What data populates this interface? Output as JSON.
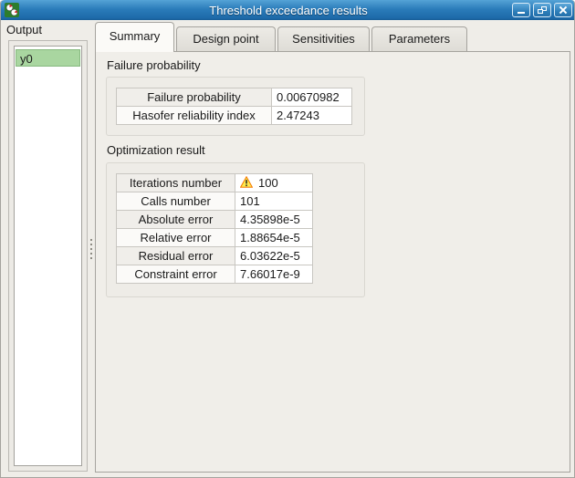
{
  "window": {
    "title": "Threshold exceedance results"
  },
  "sidebar": {
    "header": "Output",
    "items": [
      {
        "label": "y0",
        "selected": true
      }
    ]
  },
  "tabs": [
    {
      "label": "Summary",
      "active": true
    },
    {
      "label": "Design point",
      "active": false
    },
    {
      "label": "Sensitivities",
      "active": false
    },
    {
      "label": "Parameters",
      "active": false
    }
  ],
  "summary": {
    "failure_group": {
      "title": "Failure probability",
      "rows": [
        {
          "label": "Failure probability",
          "value": "0.00670982"
        },
        {
          "label": "Hasofer reliability index",
          "value": "2.47243"
        }
      ]
    },
    "optimization_group": {
      "title": "Optimization result",
      "rows": [
        {
          "label": "Iterations number",
          "value": "100",
          "warning": true
        },
        {
          "label": "Calls number",
          "value": "101"
        },
        {
          "label": "Absolute error",
          "value": "4.35898e-5"
        },
        {
          "label": "Relative error",
          "value": "1.88654e-5"
        },
        {
          "label": "Residual error",
          "value": "6.03622e-5"
        },
        {
          "label": "Constraint error",
          "value": "7.66017e-9"
        }
      ]
    }
  },
  "icons": {
    "window_icon": "openturns-logo",
    "minimize": "minimize-icon",
    "restore": "restore-icon",
    "close": "close-icon",
    "warning": "warning-triangle-icon"
  },
  "colors": {
    "titlebar_blue": "#2b7cba",
    "selection_green": "#a9d6a0",
    "warning_yellow": "#fce94f",
    "warning_orange": "#f57900",
    "pane_background": "#f0eee9"
  }
}
